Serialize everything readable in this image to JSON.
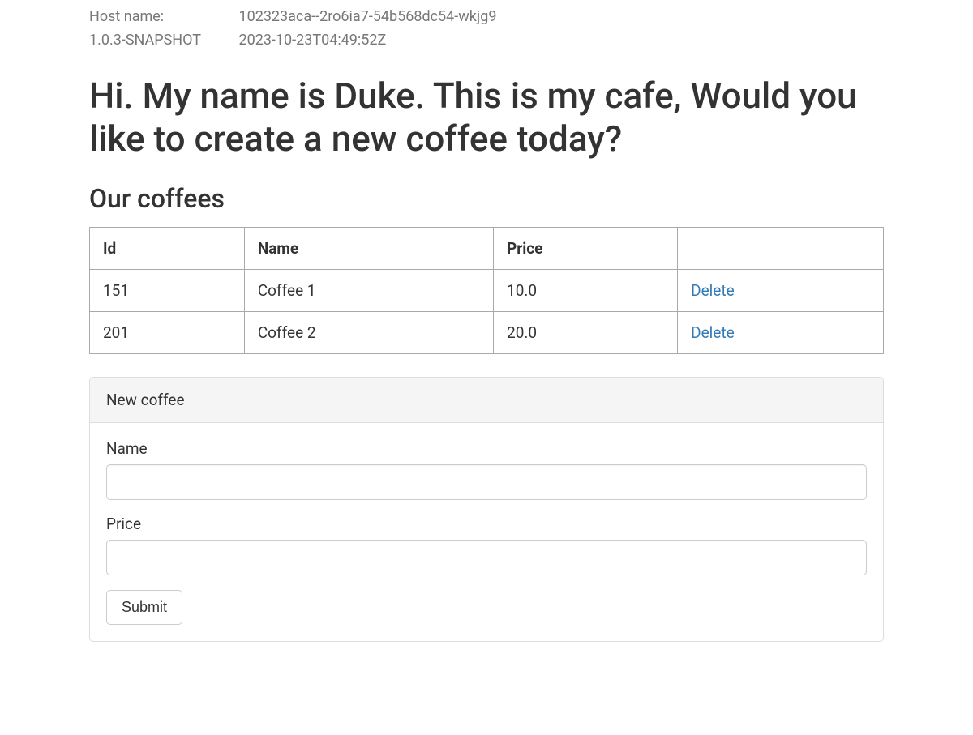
{
  "meta": {
    "host_label": "Host name:",
    "host_value": "102323aca--2ro6ia7-54b568dc54-wkjg9",
    "version_label": "1.0.3-SNAPSHOT",
    "build_time": "2023-10-23T04:49:52Z"
  },
  "heading": "Hi. My name is Duke. This is my cafe, Would you like to create a new coffee today?",
  "coffees_heading": "Our coffees",
  "table": {
    "headers": {
      "id": "Id",
      "name": "Name",
      "price": "Price",
      "actions": ""
    },
    "rows": [
      {
        "id": "151",
        "name": "Coffee 1",
        "price": "10.0",
        "delete_label": "Delete"
      },
      {
        "id": "201",
        "name": "Coffee 2",
        "price": "20.0",
        "delete_label": "Delete"
      }
    ]
  },
  "form": {
    "panel_title": "New coffee",
    "name_label": "Name",
    "name_value": "",
    "price_label": "Price",
    "price_value": "",
    "submit_label": "Submit"
  }
}
